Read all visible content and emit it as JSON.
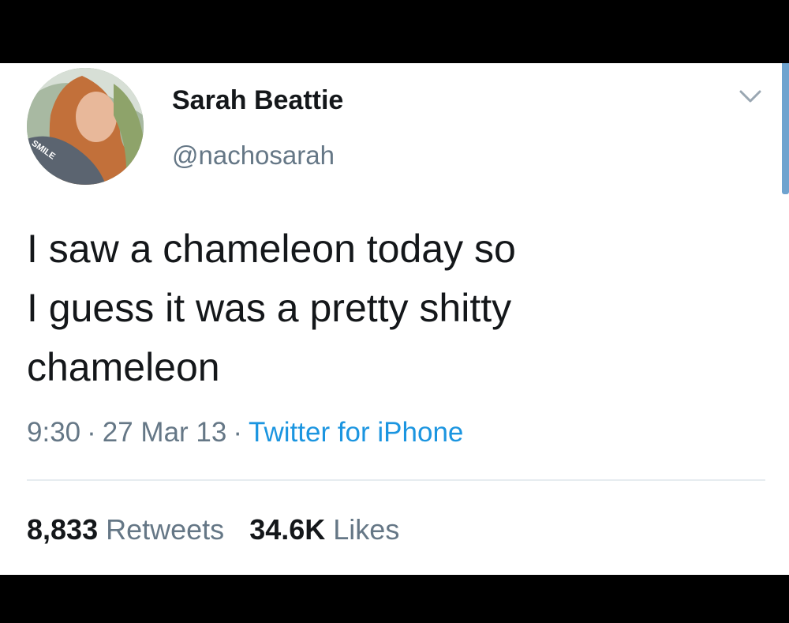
{
  "tweet": {
    "author_name": "Sarah Beattie",
    "author_handle": "@nachosarah",
    "avatar_overlay_text": "SMILE",
    "text": "I saw a chameleon today so\nI guess it was a pretty shitty\nchameleon",
    "time": "9:30",
    "date": "27 Mar 13",
    "separator": "·",
    "source": "Twitter for iPhone",
    "retweets_count": "8,833",
    "retweets_label": "Retweets",
    "likes_count": "34.6K",
    "likes_label": "Likes"
  },
  "icons": {
    "menu": "chevron-down-icon"
  },
  "colors": {
    "text_primary": "#14171a",
    "text_secondary": "#657786",
    "link": "#1b95e0",
    "background": "#ffffff",
    "divider": "#e6ecf0"
  }
}
